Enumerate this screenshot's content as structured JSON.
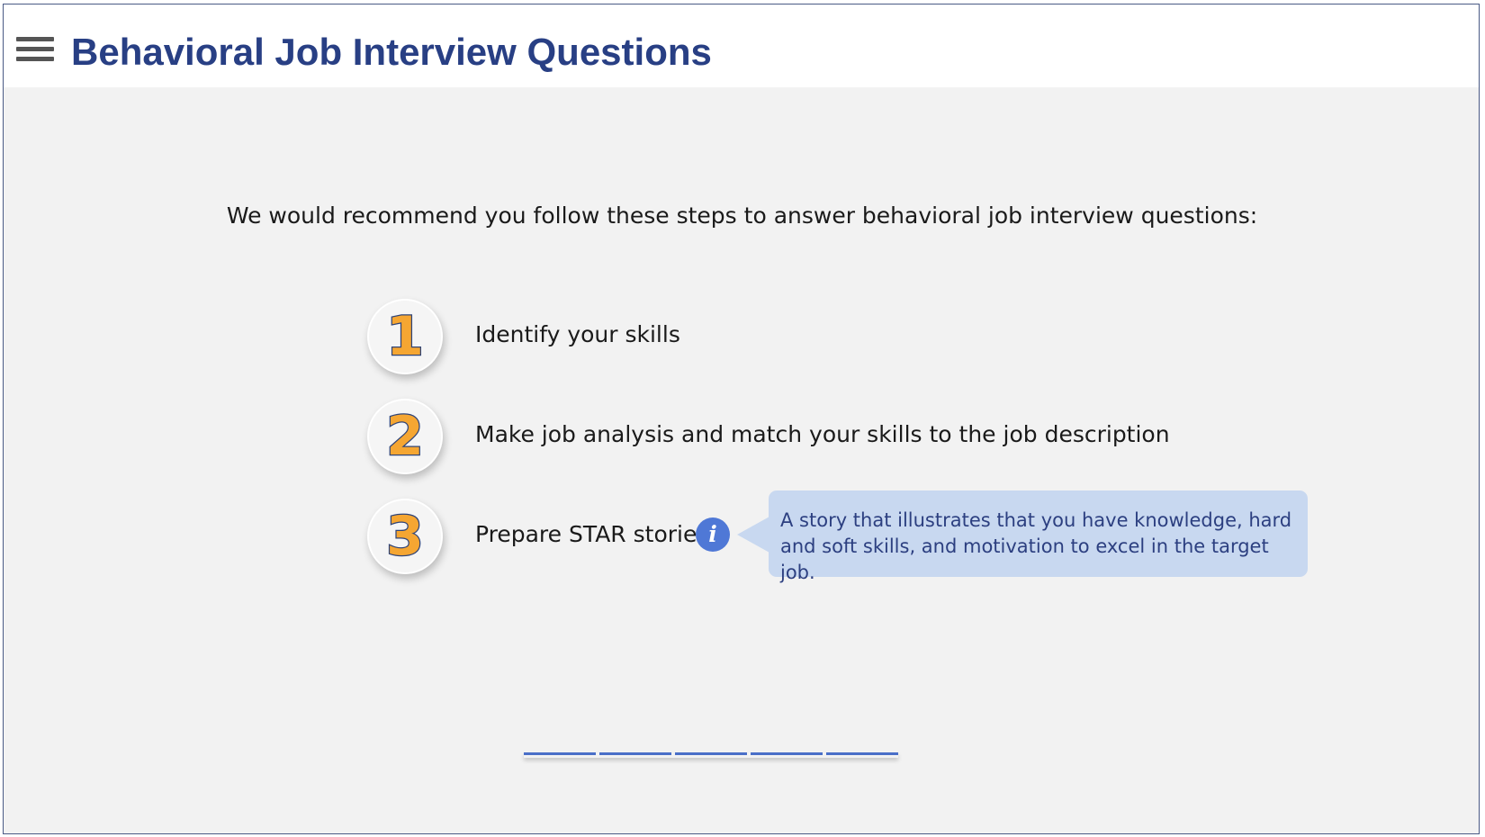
{
  "header": {
    "title": "Behavioral Job Interview Questions",
    "menu_icon": "hamburger-menu-icon"
  },
  "main": {
    "intro": "We would recommend you follow these steps to answer behavioral job interview questions:",
    "steps": [
      {
        "number": "1",
        "label": "Identify your skills"
      },
      {
        "number": "2",
        "label": "Make job analysis and match your skills to the job description"
      },
      {
        "number": "3",
        "label": "Prepare STAR stories"
      }
    ],
    "info": {
      "icon": "info-icon",
      "glyph": "i",
      "tooltip": "A story that illustrates that you have knowledge, hard and soft skills, and motivation to excel in the target job."
    }
  },
  "progress": {
    "segments": 5,
    "color": "#4a6fc8"
  },
  "colors": {
    "title": "#283f84",
    "accent": "#f5a632",
    "tooltip_bg": "#c8d8f0",
    "info": "#4f78d6"
  }
}
